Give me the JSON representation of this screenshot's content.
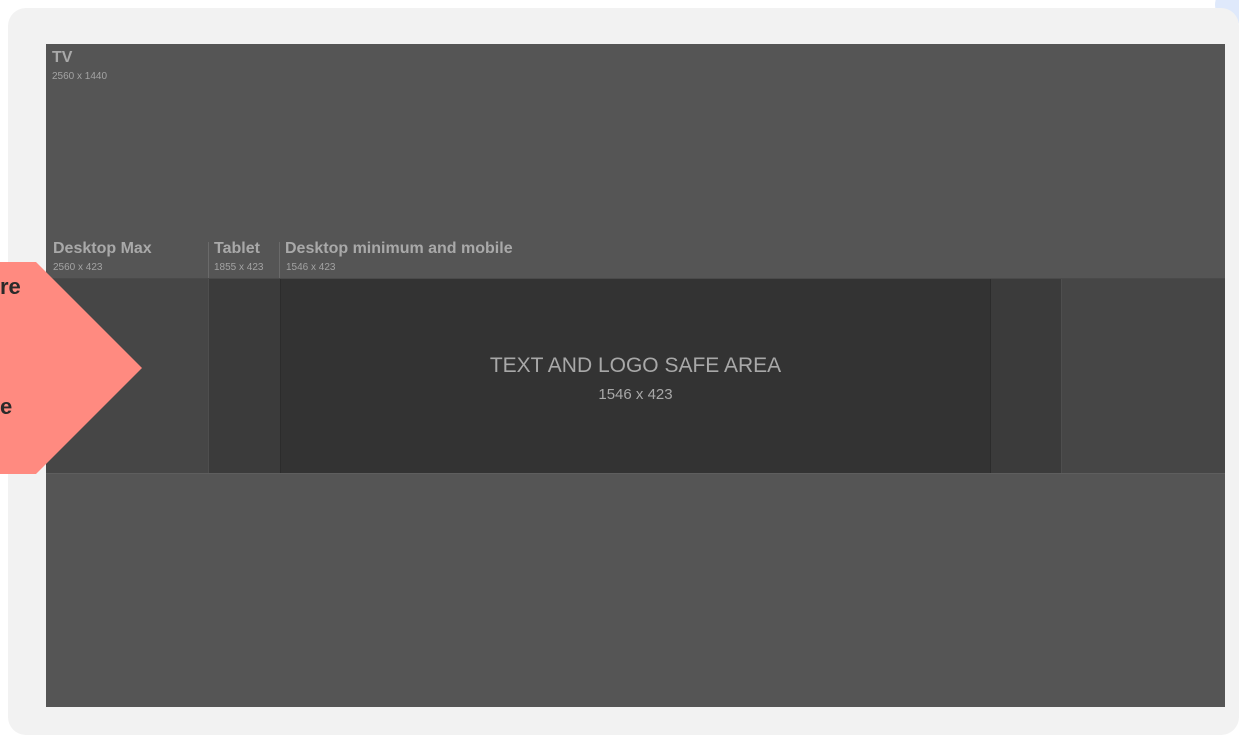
{
  "regions": {
    "tv": {
      "title": "TV",
      "size": "2560 x 1440"
    },
    "desktop_max": {
      "title": "Desktop Max",
      "size": "2560 x 423"
    },
    "tablet": {
      "title": "Tablet",
      "size": "1855 x 423"
    },
    "desktop_min": {
      "title": "Desktop minimum and mobile",
      "size": "1546 x 423"
    }
  },
  "safe_area": {
    "title": "TEXT AND LOGO SAFE AREA",
    "size": "1546 x 423"
  },
  "callout": {
    "fragment_top": "re",
    "fragment_bottom": "e",
    "color": "#ff8a80"
  },
  "colors": {
    "card_background": "#f2f2f2",
    "tv_area": "#555555",
    "desktop_max_area": "#464646",
    "tablet_area": "#3b3b3b",
    "safe_area": "#333333",
    "label_text": "#a9a9a9"
  }
}
